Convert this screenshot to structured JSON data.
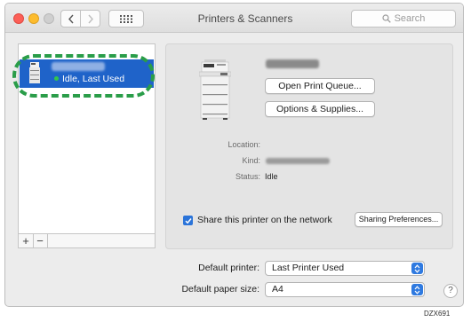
{
  "window": {
    "title": "Printers & Scanners",
    "search_placeholder": "Search"
  },
  "list": {
    "selected_status": "Idle, Last Used",
    "add_label": "+",
    "remove_label": "−"
  },
  "details": {
    "open_queue_label": "Open Print Queue...",
    "options_label": "Options & Supplies...",
    "location_label": "Location:",
    "kind_label": "Kind:",
    "status_label": "Status:",
    "status_value": "Idle",
    "share_label": "Share this printer on the network",
    "share_checked": true,
    "sharing_prefs_label": "Sharing Preferences..."
  },
  "defaults": {
    "printer_label": "Default printer:",
    "printer_value": "Last Printer Used",
    "paper_label": "Default paper size:",
    "paper_value": "A4",
    "help_label": "?"
  },
  "figure_code": "DZX691",
  "colors": {
    "selection": "#1f63c9",
    "highlight": "#2a9d49",
    "status_dot": "#33c64a",
    "accent": "#2f7ae0"
  },
  "icons": [
    "back-icon",
    "forward-icon",
    "grid-icon",
    "search-icon",
    "printer-icon",
    "check-icon",
    "popup-arrows-icon"
  ]
}
